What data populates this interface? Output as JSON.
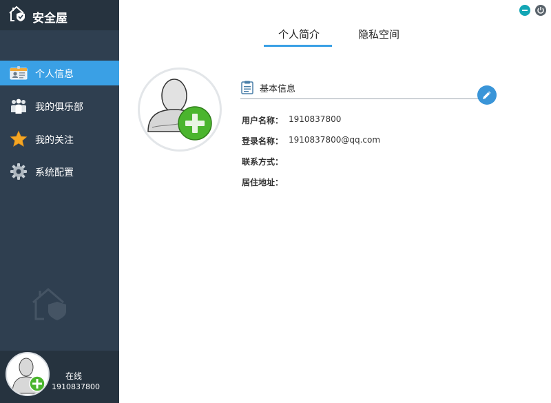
{
  "app": {
    "title": "安全屋"
  },
  "sidebar": {
    "items": [
      {
        "label": "个人信息",
        "icon": "id-card-icon",
        "active": true
      },
      {
        "label": "我的俱乐部",
        "icon": "group-icon",
        "active": false
      },
      {
        "label": "我的关注",
        "icon": "star-icon",
        "active": false
      },
      {
        "label": "系统配置",
        "icon": "gear-icon",
        "active": false
      }
    ]
  },
  "user": {
    "status": "在线",
    "id": "1910837800"
  },
  "window_controls": {
    "minimize_icon": "minimize-icon",
    "power_icon": "power-icon"
  },
  "tabs": [
    {
      "label": "个人简介",
      "active": true
    },
    {
      "label": "隐私空间",
      "active": false
    }
  ],
  "profile": {
    "section_title": "基本信息",
    "fields": [
      {
        "label": "用户名称：",
        "value": "1910837800"
      },
      {
        "label": "登录名称：",
        "value": "1910837800@qq.com"
      },
      {
        "label": "联系方式：",
        "value": ""
      },
      {
        "label": "居住地址：",
        "value": ""
      }
    ]
  },
  "colors": {
    "accent": "#3aa0e5",
    "sidebar": "#2f3f50",
    "sidebar_dark": "#26333f",
    "add_badge": "#4bb52e"
  }
}
